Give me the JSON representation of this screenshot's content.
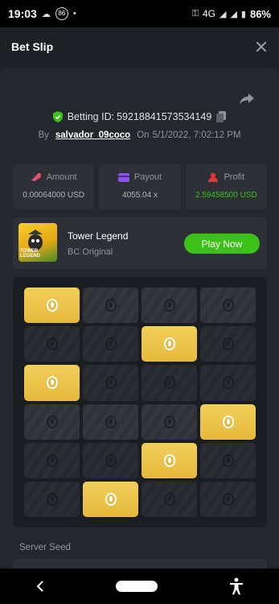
{
  "status_bar": {
    "time": "19:03",
    "badge": "86",
    "dot": "•",
    "network": "4G",
    "battery": "86%"
  },
  "header": {
    "title": "Bet Slip",
    "close_icon": "close-icon"
  },
  "bet": {
    "betting_id_label": "Betting ID:",
    "betting_id": "59218841573534149",
    "by_label": "By",
    "username": "salvador_09coco",
    "on_label": "On",
    "datetime": "5/1/2022, 7:02:12 PM"
  },
  "stats": {
    "amount_label": "Amount",
    "amount_value": "0.00064000 USD",
    "payout_label": "Payout",
    "payout_value": "4055.04 x",
    "profit_label": "Profit",
    "profit_value": "2.59458500 USD",
    "colors": {
      "amount_icon": "#e8516e",
      "payout_icon": "#8a52e8",
      "profit_icon": "#e8323a",
      "profit_text": "#3bc117"
    }
  },
  "game": {
    "thumb_text": "TOWER LEGEND",
    "name": "Tower Legend",
    "provider": "BC Original",
    "play_label": "Play Now"
  },
  "board": {
    "rows": [
      [
        "gold",
        "dark",
        "dark",
        "dark"
      ],
      [
        "dim",
        "dim",
        "gold",
        "dim"
      ],
      [
        "gold",
        "dim",
        "dim",
        "dim"
      ],
      [
        "dark",
        "dark",
        "dark",
        "gold"
      ],
      [
        "dim",
        "dim",
        "gold",
        "dim"
      ],
      [
        "dim",
        "gold",
        "dim",
        "dim"
      ]
    ]
  },
  "server_seed_label": "Server Seed"
}
